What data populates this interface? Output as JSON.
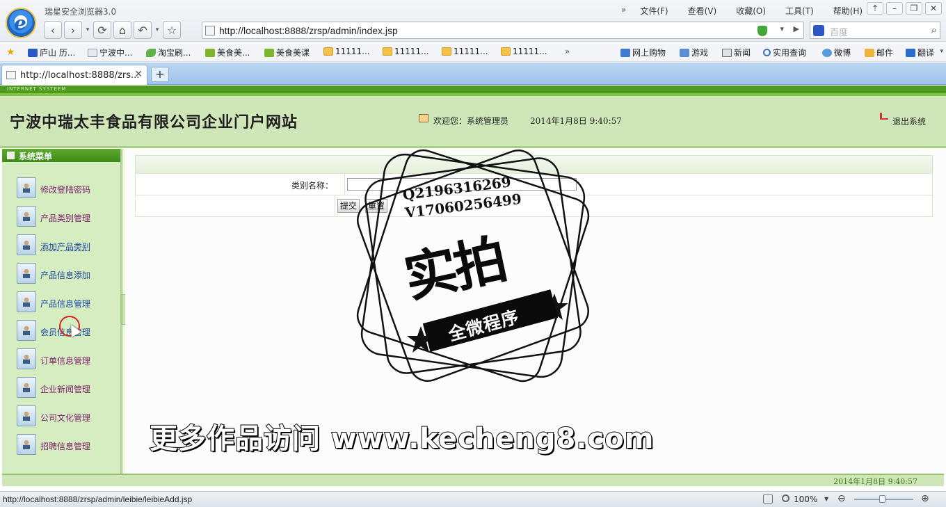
{
  "browser": {
    "app_title": "瑞星安全浏览器3.0",
    "menu": [
      "文件(F)",
      "查看(V)",
      "收藏(O)",
      "工具(T)",
      "帮助(H)"
    ],
    "menu_chevron": "»",
    "window_buttons": [
      "⇡",
      "–",
      "❐",
      "✕"
    ],
    "nav": {
      "back": "‹",
      "forward": "›",
      "refresh": "⟳",
      "home": "⌂",
      "undo": "↶",
      "star": "☆"
    },
    "address": "http://localhost:8888/zrsp/admin/index.jsp",
    "search_placeholder": "百度",
    "favorites": [
      {
        "label": "庐山 历...",
        "icon": "paw"
      },
      {
        "label": "宁波中...",
        "icon": "page"
      },
      {
        "label": "淘宝刷...",
        "icon": "leaf"
      },
      {
        "label": "美食美...",
        "icon": "iqy"
      },
      {
        "label": "美食美课",
        "icon": "iqy"
      },
      {
        "label": "11111...",
        "icon": "folder"
      },
      {
        "label": "11111...",
        "icon": "folder"
      },
      {
        "label": "11111...",
        "icon": "folder"
      },
      {
        "label": "11111...",
        "icon": "folder"
      }
    ],
    "favorites_right": [
      {
        "label": "网上购物",
        "icon": "cart"
      },
      {
        "label": "游戏",
        "icon": "game"
      },
      {
        "label": "新闻",
        "icon": "news"
      },
      {
        "label": "实用查询",
        "icon": "mag"
      },
      {
        "label": "微博",
        "icon": "weibo"
      },
      {
        "label": "邮件",
        "icon": "mail"
      },
      {
        "label": "翻译",
        "icon": "trans"
      }
    ],
    "tab_title": "http://localhost:8888/zrs...",
    "new_tab": "+",
    "status_url": "http://localhost:8888/zrsp/admin/leibie/leibieAdd.jsp",
    "zoom": "100%"
  },
  "page": {
    "strip_text": "INTERNET SYSTEEM",
    "site_title": "宁波中瑞太丰食品有限公司企业门户网站",
    "welcome": "欢迎您：系统管理员",
    "datetime": "2014年1月8日  9:40:57",
    "logout": "退出系统",
    "sidebar_title": "系统菜单",
    "sidebar_items": [
      "修改登陆密码",
      "产品类别管理",
      "添加产品类别",
      "产品信息添加",
      "产品信息管理",
      "会员信息管理",
      "订单信息管理",
      "企业新闻管理",
      "公司文化管理",
      "招聘信息管理"
    ],
    "form": {
      "category_label": "类别名称：",
      "category_value": "",
      "submit": "提交",
      "reset": "重置"
    },
    "footer_date": "2014年1月8日  9:40:57"
  },
  "watermark": {
    "qq": "Q2196316269",
    "v": "V17060256499",
    "big": "实拍",
    "ribbon": "全微程序",
    "bottom": "更多作品访问 www.kecheng8.com"
  }
}
